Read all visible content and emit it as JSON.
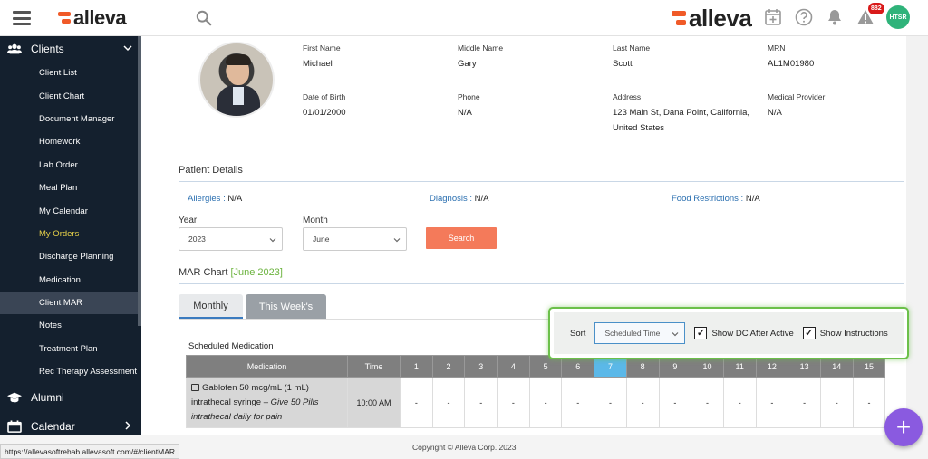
{
  "header": {
    "logo_small": "alleva",
    "logo_big": "alleva",
    "notification_count": "882",
    "user_initials": "HTSR"
  },
  "sidebar": {
    "clients_label": "Clients",
    "items": [
      "Client List",
      "Client Chart",
      "Document Manager",
      "Homework",
      "Lab Order",
      "Meal Plan",
      "My Calendar",
      "My Orders",
      "Discharge Planning",
      "Medication",
      "Client MAR",
      "Notes",
      "Treatment Plan",
      "Rec Therapy Assessment"
    ],
    "alumni_label": "Alumni",
    "calendar_label": "Calendar"
  },
  "client": {
    "first_name_label": "First Name",
    "first_name": "Michael",
    "middle_name_label": "Middle Name",
    "middle_name": "Gary",
    "last_name_label": "Last Name",
    "last_name": "Scott",
    "mrn_label": "MRN",
    "mrn": "AL1M01980",
    "dob_label": "Date of Birth",
    "dob": "01/01/2000",
    "phone_label": "Phone",
    "phone": "N/A",
    "address_label": "Address",
    "address_line1": "123 Main St, Dana Point, California,",
    "address_line2": "United States",
    "provider_label": "Medical Provider",
    "provider": "N/A"
  },
  "patient_details": {
    "title": "Patient Details",
    "allergies_label": "Allergies :",
    "allergies": " N/A",
    "diagnosis_label": "Diagnosis :",
    "diagnosis": " N/A",
    "food_label": "Food Restrictions :",
    "food": " N/A"
  },
  "filters": {
    "year_label": "Year",
    "year_value": "2023",
    "month_label": "Month",
    "month_value": "June",
    "search_label": "Search"
  },
  "mar": {
    "title": "MAR Chart ",
    "month": "[June 2023]",
    "tab_monthly": "Monthly",
    "tab_week": "This Week's",
    "scheduled_label": "Scheduled Medication",
    "sort_label": "Sort",
    "sort_value": "Scheduled Time",
    "show_dc_label": "Show DC After Active",
    "show_instructions_label": "Show Instructions",
    "check_mark": "✓",
    "columns": {
      "medication": "Medication",
      "time": "Time",
      "days": [
        "1",
        "2",
        "3",
        "4",
        "5",
        "6",
        "7",
        "8",
        "9",
        "10",
        "11",
        "12",
        "13",
        "14",
        "15"
      ]
    },
    "today_index": 6,
    "row": {
      "med_line1": "Gablofen 50 mcg/mL (1 mL)",
      "med_line2": "intrathecal syringe – ",
      "med_instr1": "Give 50 Pills",
      "med_instr2": "intrathecal daily for pain",
      "time": "10:00 AM",
      "cell": "-"
    }
  },
  "footer": {
    "copyright": "Copyright © Alleva Corp. 2023",
    "status_url": "https://allevasoftrehab.allevasoft.com/#/clientMAR",
    "fab": "+"
  }
}
